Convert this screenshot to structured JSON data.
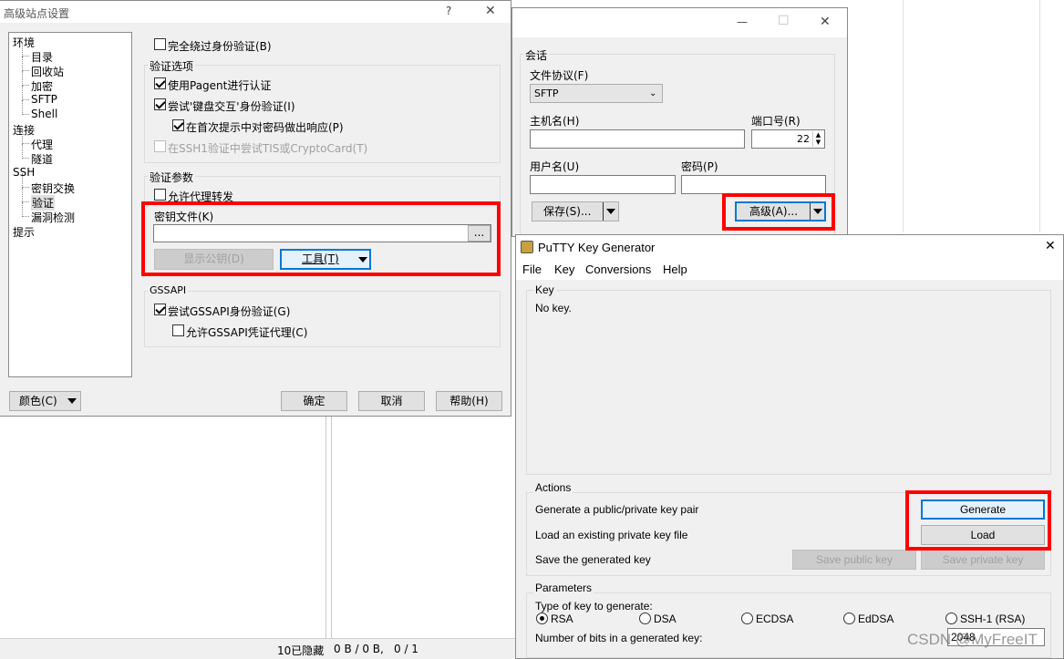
{
  "adv": {
    "title": "高级站点设置",
    "help_icon": "?",
    "close_icon": "✕",
    "tree": [
      {
        "label": "环境",
        "level": 0
      },
      {
        "label": "目录",
        "level": 1
      },
      {
        "label": "回收站",
        "level": 1
      },
      {
        "label": "加密",
        "level": 1
      },
      {
        "label": "SFTP",
        "level": 1
      },
      {
        "label": "Shell",
        "level": 1
      },
      {
        "label": "连接",
        "level": 0
      },
      {
        "label": "代理",
        "level": 1
      },
      {
        "label": "隧道",
        "level": 1
      },
      {
        "label": "SSH",
        "level": 0
      },
      {
        "label": "密钥交换",
        "level": 1
      },
      {
        "label": "验证",
        "level": 1,
        "selected": true
      },
      {
        "label": "漏洞检测",
        "level": 1
      },
      {
        "label": "提示",
        "level": 0
      }
    ],
    "bypass_auth": "完全绕过身份验证(B)",
    "auth_options": "验证选项",
    "use_pageant": "使用Pagent进行认证",
    "try_keyboard": "尝试'键盘交互'身份验证(I)",
    "respond_password": "在首次提示中对密码做出响应(P)",
    "try_tis": "在SSH1验证中尝试TIS或CryptoCard(T)",
    "auth_params": "验证参数",
    "allow_agent": "允许代理转发",
    "key_file": "密钥文件(K)",
    "browse": "...",
    "show_pubkey": "显示公钥(D)",
    "tools": "工具(T)",
    "gssapi": "GSSAPI",
    "try_gssapi": "尝试GSSAPI身份验证(G)",
    "allow_gssapi": "允许GSSAPI凭证代理(C)",
    "color": "颜色(C)",
    "ok": "确定",
    "cancel": "取消",
    "help": "帮助(H)"
  },
  "login": {
    "minimize_icon": "—",
    "maximize_icon": "☐",
    "close_icon": "✕",
    "session": "会话",
    "protocol_label": "文件协议(F)",
    "protocol_value": "SFTP",
    "host_label": "主机名(H)",
    "port_label": "端口号(R)",
    "port_value": "22",
    "user_label": "用户名(U)",
    "pass_label": "密码(P)",
    "save": "保存(S)...",
    "advanced": "高级(A)..."
  },
  "putty": {
    "title": "PuTTY Key Generator",
    "close_icon": "✕",
    "menu": [
      "File",
      "Key",
      "Conversions",
      "Help"
    ],
    "key_group": "Key",
    "no_key": "No key.",
    "actions": "Actions",
    "gen_label": "Generate a public/private key pair",
    "load_label": "Load an existing private key file",
    "save_label": "Save the generated key",
    "generate": "Generate",
    "load": "Load",
    "save_public": "Save public key",
    "save_private": "Save private key",
    "parameters": "Parameters",
    "type_label": "Type of key to generate:",
    "types": [
      "RSA",
      "DSA",
      "ECDSA",
      "EdDSA",
      "SSH-1 (RSA)"
    ],
    "selected_type": "RSA",
    "bits_label": "Number of bits in a generated key:",
    "bits_value": "2048"
  },
  "status": {
    "hidden": "10已隐藏",
    "size": "0 B / 0 B,",
    "count": "0 / 1"
  },
  "watermark": "CSDN @MyFreeIT",
  "colors": {
    "highlight": "#ff0000",
    "accent": "#0078d7",
    "panel": "#f0f0f0"
  }
}
